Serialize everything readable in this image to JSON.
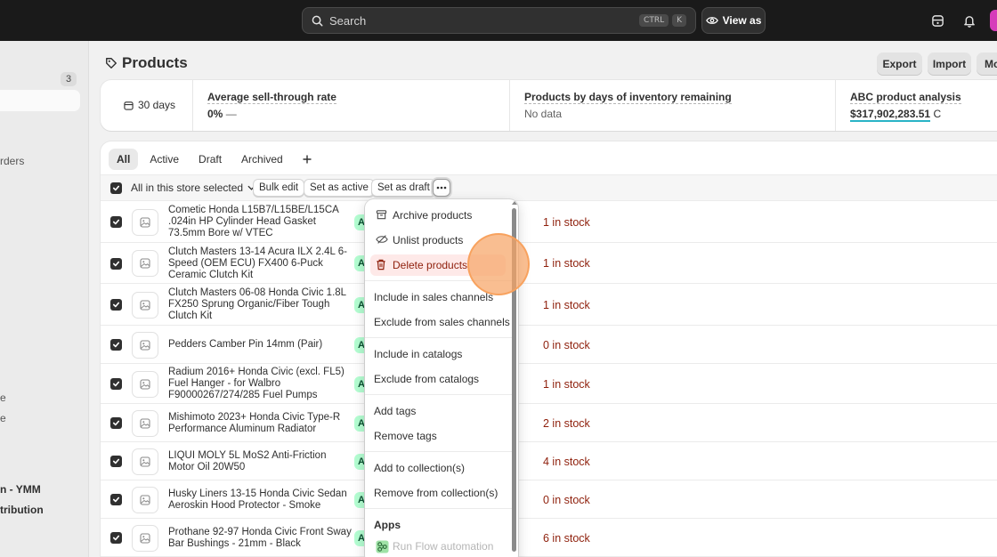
{
  "topbar": {
    "search_label": "Search",
    "shortcut_ctrl": "CTRL",
    "shortcut_key": "K",
    "view_as_label": "View as"
  },
  "sidebar": {
    "badge_count": "3",
    "fragments": [
      "rders",
      "e",
      "e",
      "n - YMM",
      "tribution"
    ]
  },
  "header": {
    "title": "Products",
    "export_label": "Export",
    "import_label": "Import",
    "more_label": "Mo"
  },
  "analytics": {
    "date_range": "30 days",
    "sell_through_title": "Average sell-through rate",
    "sell_through_value": "0%",
    "sell_through_trend": "—",
    "inventory_days_title": "Products by days of inventory remaining",
    "inventory_days_value": "No data",
    "abc_title": "ABC product analysis",
    "abc_value": "$317,902,283.51",
    "abc_suffix": "C"
  },
  "tabs": [
    "All",
    "Active",
    "Draft",
    "Archived"
  ],
  "bulk_actions": {
    "selection_label": "All in this store selected",
    "bulk_edit": "Bulk edit",
    "set_active": "Set as active",
    "set_draft": "Set as draft"
  },
  "products": [
    {
      "name": "Cometic Honda L15B7/L15BE/L15CA .024in HP Cylinder Head Gasket 73.5mm Bore w/ VTEC",
      "status": "A",
      "stock": "1 in stock"
    },
    {
      "name": "Clutch Masters 13-14 Acura ILX 2.4L 6-Speed (OEM ECU) FX400 6-Puck Ceramic Clutch Kit",
      "status": "A",
      "stock": "1 in stock"
    },
    {
      "name": "Clutch Masters 06-08 Honda Civic 1.8L FX250 Sprung Organic/Fiber Tough Clutch Kit",
      "status": "A",
      "stock": "1 in stock"
    },
    {
      "name": "Pedders Camber Pin 14mm (Pair)",
      "status": "A",
      "stock": "0 in stock"
    },
    {
      "name": "Radium 2016+ Honda Civic (excl. FL5) Fuel Hanger - for Walbro F90000267/274/285 Fuel Pumps",
      "status": "A",
      "stock": "1 in stock"
    },
    {
      "name": "Mishimoto 2023+ Honda Civic Type-R Performance Aluminum Radiator",
      "status": "A",
      "stock": "2 in stock"
    },
    {
      "name": "LIQUI MOLY 5L MoS2 Anti-Friction Motor Oil 20W50",
      "status": "A",
      "stock": "4 in stock"
    },
    {
      "name": "Husky Liners 13-15 Honda Civic Sedan Aeroskin Hood Protector - Smoke",
      "status": "A",
      "stock": "0 in stock"
    },
    {
      "name": "Prothane 92-97 Honda Civic Front Sway Bar Bushings - 21mm - Black",
      "status": "A",
      "stock": "6 in stock"
    }
  ],
  "menu": {
    "archive": "Archive products",
    "unlist": "Unlist products",
    "delete": "Delete products",
    "include_channels": "Include in sales channels",
    "exclude_channels": "Exclude from sales channels",
    "include_catalogs": "Include in catalogs",
    "exclude_catalogs": "Exclude from catalogs",
    "add_tags": "Add tags",
    "remove_tags": "Remove tags",
    "add_collection": "Add to collection(s)",
    "remove_collection": "Remove from collection(s)",
    "apps_heading": "Apps",
    "run_flow": "Run Flow automation"
  },
  "colors": {
    "danger": "#8e1f0b",
    "danger_bg": "#fee9e8",
    "accent_teal": "#29b3c6",
    "status_green": "#b4fed2"
  }
}
